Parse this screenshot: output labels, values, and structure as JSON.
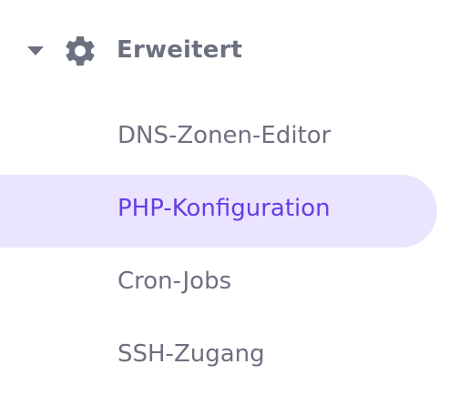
{
  "section": {
    "title": "Erweitert",
    "icon": "gear-icon",
    "expanded": true
  },
  "menu": {
    "items": [
      {
        "label": "DNS-Zonen-Editor",
        "active": false
      },
      {
        "label": "PHP-Konfiguration",
        "active": true
      },
      {
        "label": "Cron-Jobs",
        "active": false
      },
      {
        "label": "SSH-Zugang",
        "active": false
      }
    ]
  },
  "colors": {
    "text": "#6d7081",
    "accent": "#673de6",
    "active_bg": "#ebe4ff"
  }
}
